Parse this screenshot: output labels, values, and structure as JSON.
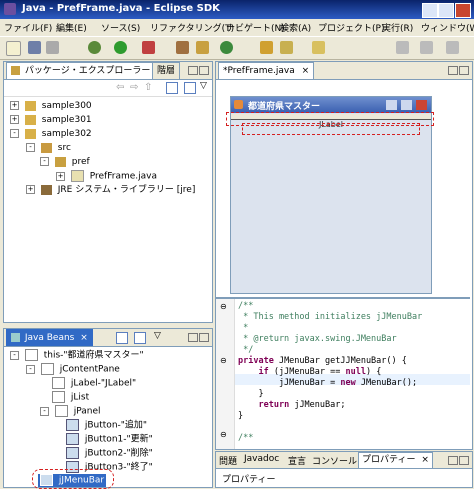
{
  "window": {
    "title": "Java - PrefFrame.java - Eclipse SDK"
  },
  "menu": [
    "ファイル(F)",
    "編集(E)",
    "ソース(S)",
    "リファクタリング(T)",
    "ナビゲート(N)",
    "検索(A)",
    "プロジェクト(P)",
    "実行(R)",
    "ウィンドウ(W)"
  ],
  "package_explorer": {
    "tab_label": "パッケージ・エクスプローラー",
    "tab_close": "×",
    "second_tab": "階層",
    "tree": [
      {
        "label": "sample300",
        "expander": "+"
      },
      {
        "label": "sample301",
        "expander": "+"
      },
      {
        "label": "sample302",
        "expander": "-"
      },
      {
        "label": "src",
        "expander": "-"
      },
      {
        "label": "pref",
        "expander": "-"
      },
      {
        "label": "PrefFrame.java",
        "expander": "+"
      },
      {
        "label": "JRE システム・ライブラリー [jre]",
        "expander": "+"
      }
    ]
  },
  "editor": {
    "tab_label": "*PrefFrame.java",
    "tab_close": "×",
    "frame_title": "都道府県マスター",
    "jlabel_text": "JLabel",
    "code_lines": [
      "/**",
      " * This method initializes jJMenuBar",
      " *",
      " * @return javax.swing.JMenuBar",
      " */",
      "private JMenuBar getJJMenuBar() {",
      "    if (jJMenuBar == null) {",
      "        jJMenuBar = new JMenuBar();",
      "    }",
      "    return jJMenuBar;",
      "}",
      "",
      "/**"
    ]
  },
  "java_beans": {
    "tab_label": "Java Beans",
    "tab_close": "×",
    "tree": [
      {
        "label": "this-\"都道府県マスター\""
      },
      {
        "label": "jContentPane"
      },
      {
        "label": "jLabel-\"JLabel\""
      },
      {
        "label": "jList"
      },
      {
        "label": "jPanel"
      },
      {
        "label": "jButton-\"追加\""
      },
      {
        "label": "jButton1-\"更新\""
      },
      {
        "label": "jButton2-\"削除\""
      },
      {
        "label": "jButton3-\"終了\""
      },
      {
        "label": "jJMenuBar"
      }
    ]
  },
  "bottom_panel": {
    "tabs": [
      "問題",
      "Javadoc",
      "宣言",
      "コンソール",
      "プロパティー"
    ],
    "close": "×",
    "header": "プロパティー"
  },
  "colors": {
    "accent": "#0a246a",
    "highlight": "#316ac5",
    "annotation": "#d42020"
  }
}
